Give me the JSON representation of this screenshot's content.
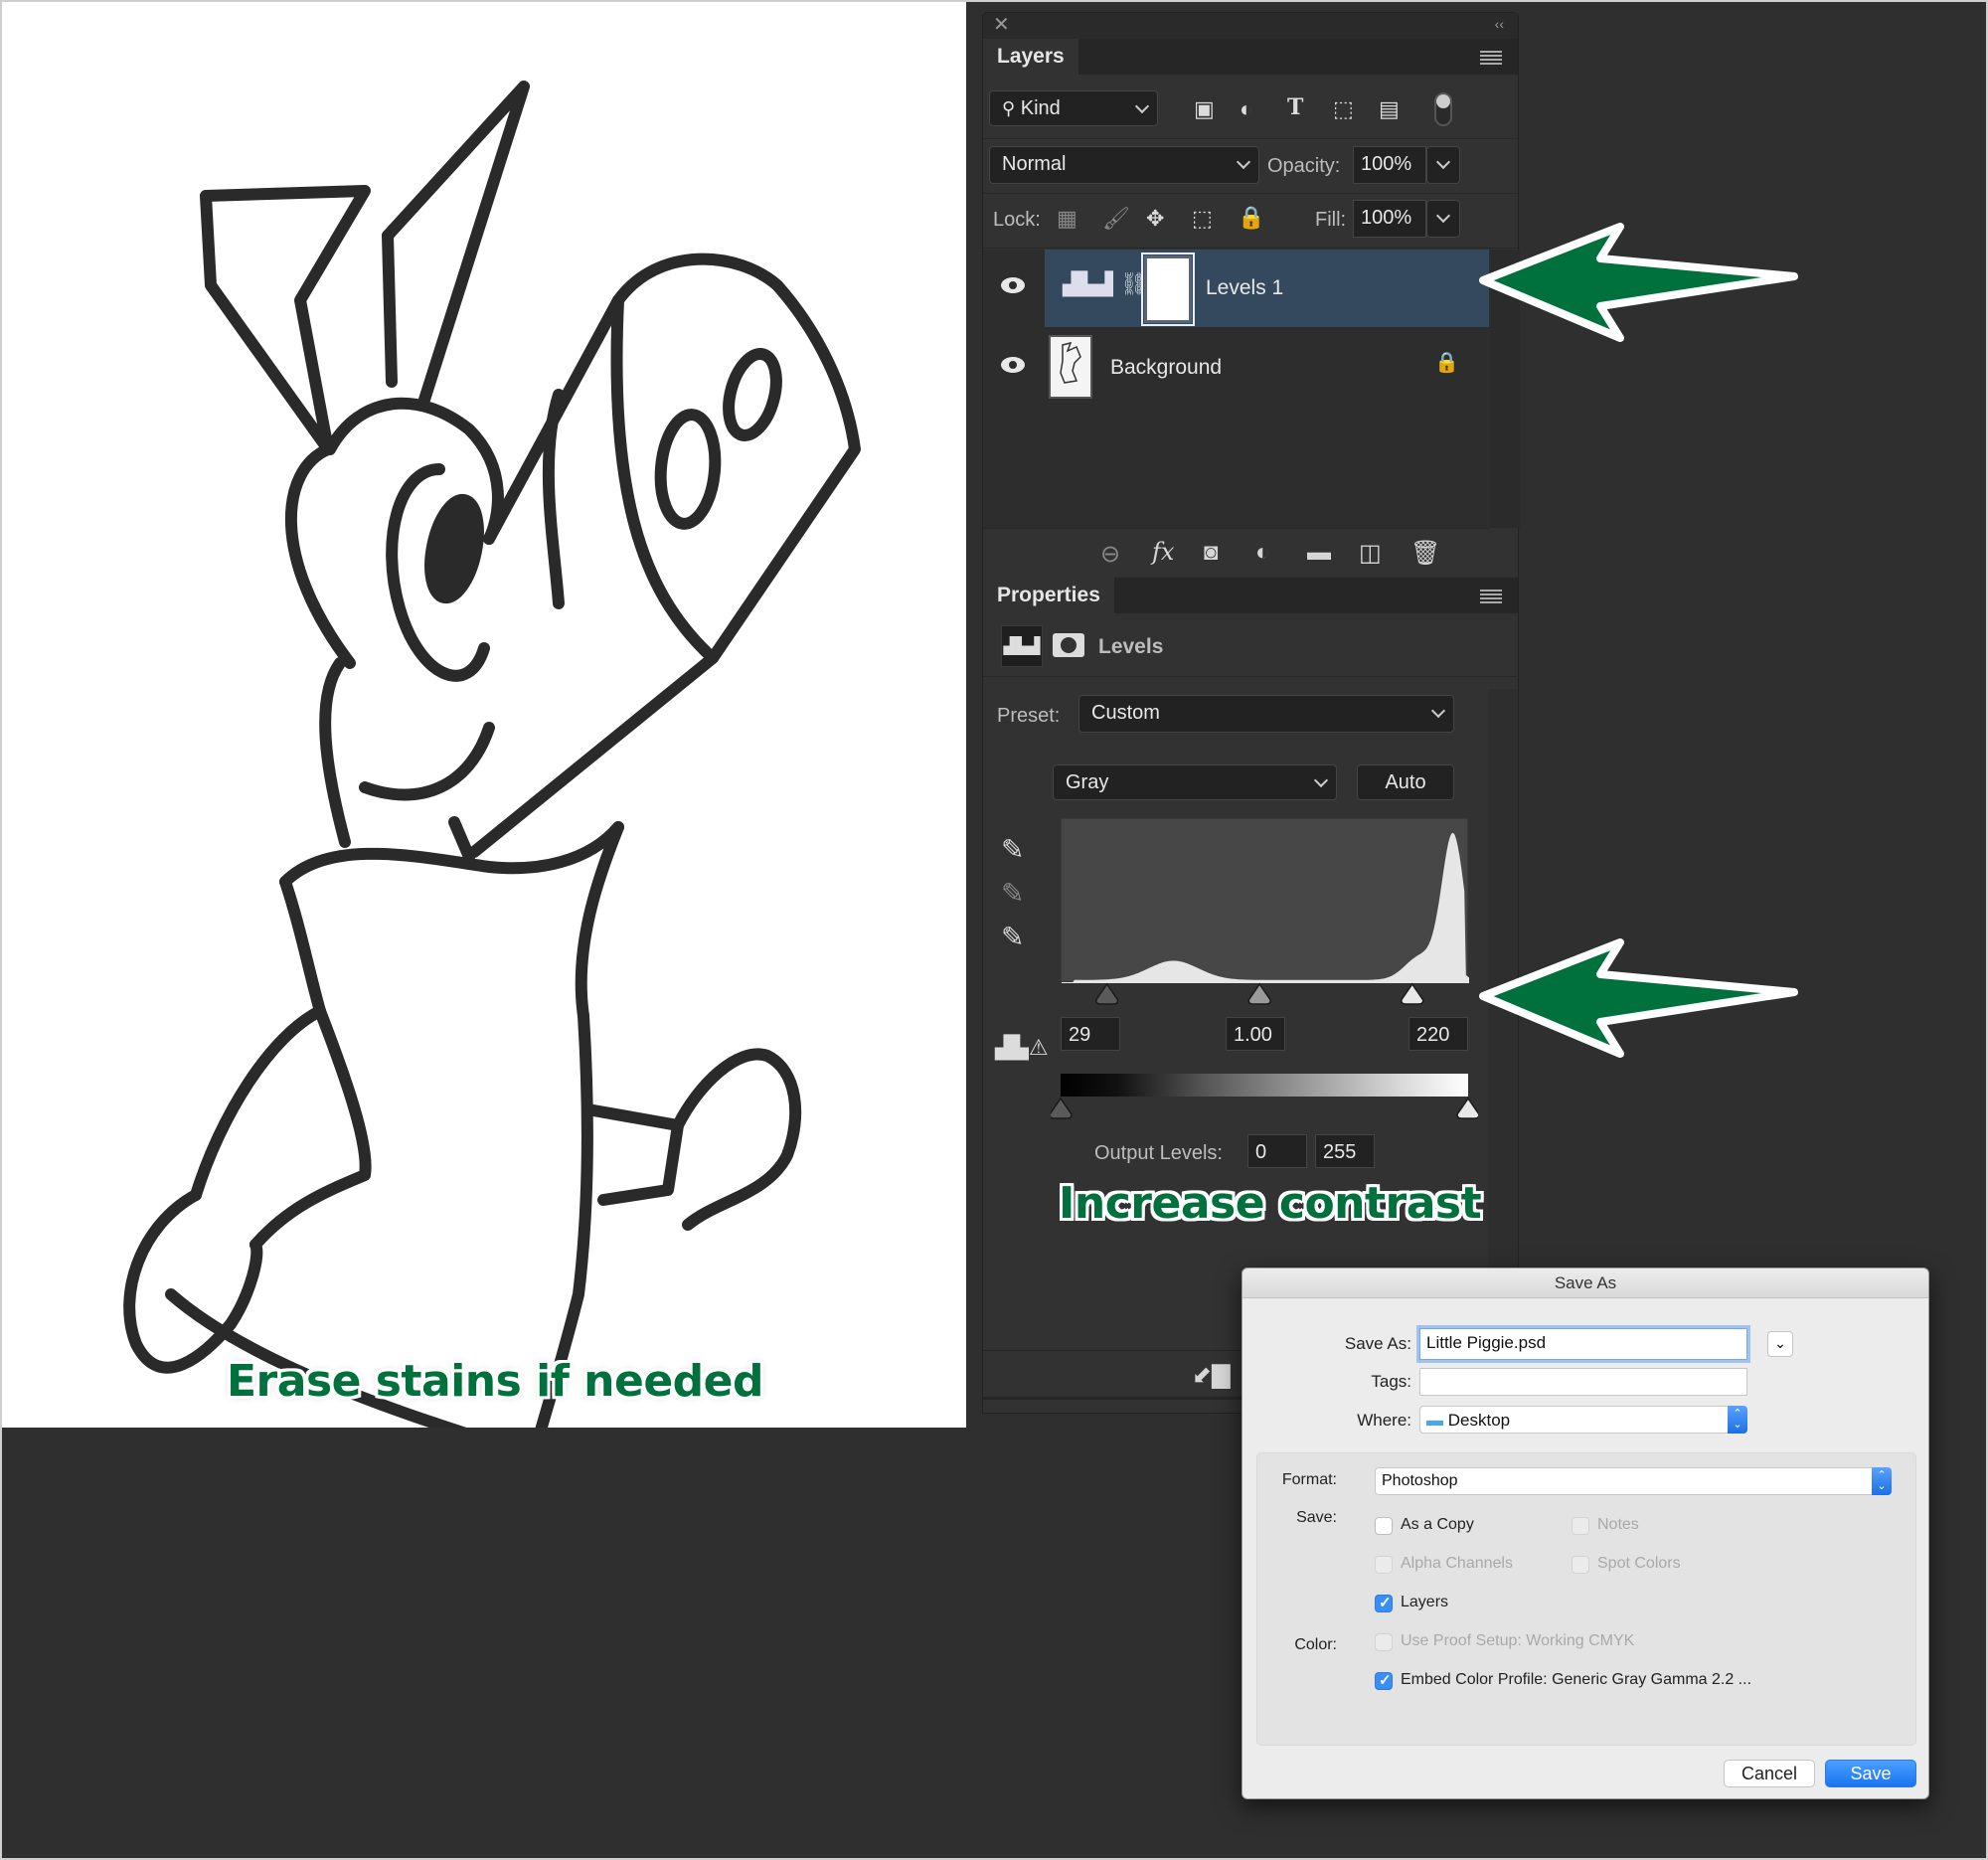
{
  "annotations": {
    "left_caption": "Erase stains if needed",
    "levels_caption": "Increase contrast",
    "arrow_color": "#00703c"
  },
  "layers_panel": {
    "title": "Layers",
    "filter_kind": "Kind",
    "filter_icons": [
      "image-filter-icon",
      "adjustment-filter-icon",
      "type-filter-icon",
      "shape-filter-icon",
      "smart-object-filter-icon",
      "filter-toggle"
    ],
    "blend_mode": "Normal",
    "opacity_label": "Opacity:",
    "opacity_value": "100%",
    "lock_label": "Lock:",
    "fill_label": "Fill:",
    "fill_value": "100%",
    "layers": [
      {
        "name": "Levels 1",
        "type": "adjustment",
        "visible": true,
        "selected": true
      },
      {
        "name": "Background",
        "type": "pixel",
        "visible": true,
        "locked": true
      }
    ],
    "footer_icons": [
      "link-layers-icon",
      "fx-icon",
      "add-mask-icon",
      "new-adjustment-icon",
      "new-group-icon",
      "new-layer-icon",
      "delete-layer-icon"
    ]
  },
  "properties_panel": {
    "title": "Properties",
    "adjustment_name": "Levels",
    "preset_label": "Preset:",
    "preset_value": "Custom",
    "channel_value": "Gray",
    "auto_label": "Auto",
    "input_black": "29",
    "input_gamma": "1.00",
    "input_white": "220",
    "output_label": "Output Levels:",
    "output_black": "0",
    "output_white": "255",
    "histogram": {
      "range": [
        0,
        255
      ],
      "shape": "small hump around 60-80, near-flat mid-tones, tall sharp peak around 235-250",
      "input_sliders": [
        29,
        1.0,
        220
      ],
      "output_sliders": [
        0,
        255
      ]
    }
  },
  "save_dialog": {
    "title": "Save As",
    "save_as_label": "Save As:",
    "filename": "Little Piggie.psd",
    "tags_label": "Tags:",
    "tags_value": "",
    "where_label": "Where:",
    "where_value": "Desktop",
    "format_label": "Format:",
    "format_value": "Photoshop",
    "save_label": "Save:",
    "color_label": "Color:",
    "options": [
      {
        "label": "As a Copy",
        "checked": false,
        "enabled": true
      },
      {
        "label": "Notes",
        "checked": false,
        "enabled": false
      },
      {
        "label": "Alpha Channels",
        "checked": false,
        "enabled": false
      },
      {
        "label": "Spot Colors",
        "checked": false,
        "enabled": false
      },
      {
        "label": "Layers",
        "checked": true,
        "enabled": true
      },
      {
        "label": "Use Proof Setup:  Working CMYK",
        "checked": false,
        "enabled": false
      },
      {
        "label": "Embed Color Profile:  Generic Gray Gamma 2.2 ...",
        "checked": true,
        "enabled": true
      }
    ],
    "cancel_label": "Cancel",
    "save_button_label": "Save"
  }
}
